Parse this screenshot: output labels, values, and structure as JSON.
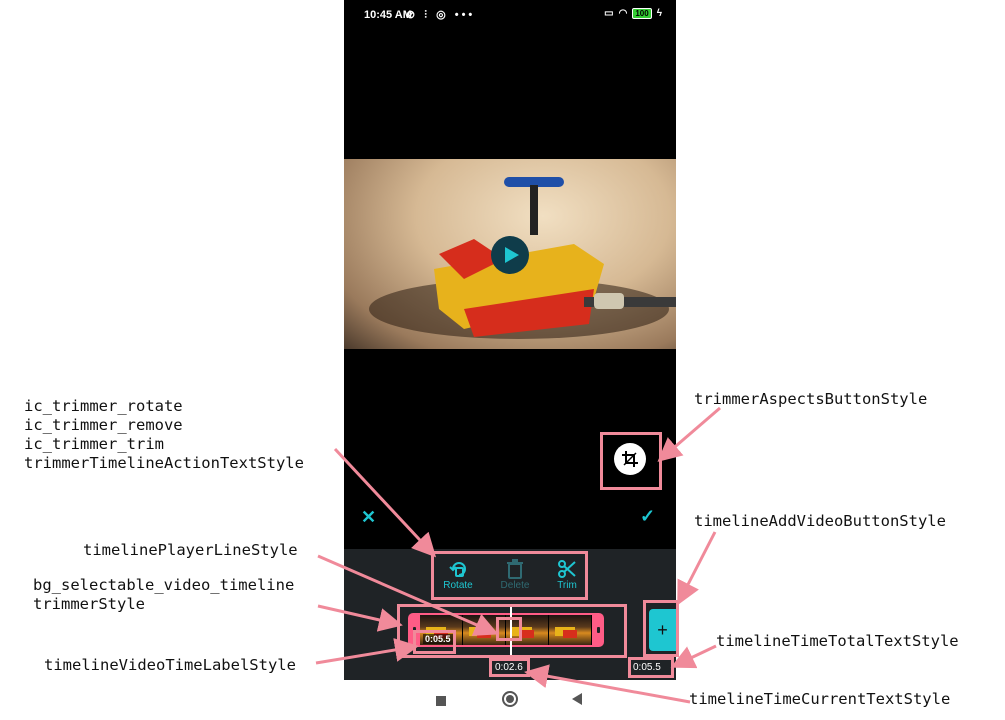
{
  "status_bar": {
    "time": "10:45 AM",
    "icons": "⊘ ⫶ ◎ •••",
    "battery": "100"
  },
  "actions": [
    {
      "label": "Rotate",
      "icon": "rotate-icon",
      "enabled": true
    },
    {
      "label": "Delete",
      "icon": "trash-icon",
      "enabled": false
    },
    {
      "label": "Trim",
      "icon": "scissors-icon",
      "enabled": true
    }
  ],
  "timeline": {
    "video_time_label": "0:05.5",
    "current_time": "0:02.6",
    "total_time": "0:05.5",
    "add_button_label": "+"
  },
  "controls": {
    "cancel": "✕",
    "confirm": "✓"
  },
  "annotations": {
    "rotate_group": "ic_trimmer_rotate\nic_trimmer_remove\nic_trimmer_trim\ntrimmerTimelineActionTextStyle",
    "player_line": "timelinePlayerLineStyle",
    "selectable": "bg_selectable_video_timeline\ntrimmerStyle",
    "video_time_label": "timelineVideoTimeLabelStyle",
    "aspects_button": "trimmerAspectsButtonStyle",
    "add_video_button": "timelineAddVideoButtonStyle",
    "time_total": "timelineTimeTotalTextStyle",
    "time_current": "timelineTimeCurrentTextStyle"
  },
  "colors": {
    "accent": "#1ec6d1",
    "timeline": "#ff5c86",
    "highlight": "#f08a9a",
    "panel": "#1f2326"
  }
}
